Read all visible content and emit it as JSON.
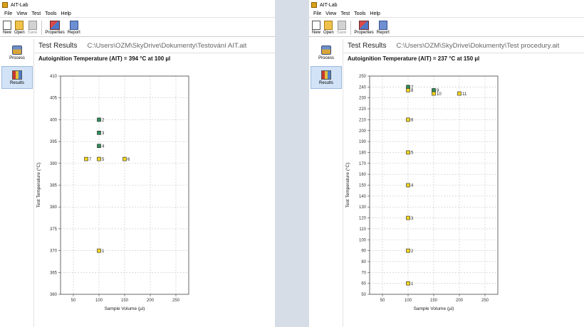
{
  "app": {
    "title": "AIT-Lab",
    "menu": [
      "File",
      "View",
      "Test",
      "Tools",
      "Help"
    ],
    "toolbar": {
      "new": "New",
      "open": "Open",
      "save": "Save",
      "properties": "Properties",
      "report": "Report"
    },
    "nav": {
      "process": "Process",
      "results": "Results"
    },
    "icons": {
      "new": "new-file-icon",
      "open": "folder-icon",
      "save": "save-icon",
      "properties": "properties-icon",
      "report": "report-icon",
      "process": "process-icon",
      "results": "bar-chart-icon"
    }
  },
  "panels": [
    {
      "header": "Test Results",
      "path": "C:\\Users\\OZM\\SkyDrive\\Dokumenty\\Testování AIT.ait",
      "summary": "Autoignition Temperature (AIT) = 394 °C at 100 µl",
      "chart_data": {
        "type": "scatter",
        "xlabel": "Sample Volume (µl)",
        "ylabel": "Test Temperature (°C)",
        "xlim": [
          25,
          275
        ],
        "ylim": [
          360,
          410
        ],
        "xticks": [
          50,
          100,
          150,
          200,
          250
        ],
        "yticks": [
          360,
          365,
          370,
          375,
          380,
          385,
          390,
          395,
          400,
          405,
          410
        ],
        "grid": true,
        "colors": {
          "ignition": "#2e8b57",
          "no_ignition": "#f2d51d"
        },
        "points": [
          {
            "x": 100,
            "y": 370,
            "label": "1",
            "result": "no_ignition"
          },
          {
            "x": 100,
            "y": 400,
            "label": "2",
            "result": "ignition"
          },
          {
            "x": 100,
            "y": 397,
            "label": "3",
            "result": "ignition"
          },
          {
            "x": 100,
            "y": 394,
            "label": "4",
            "result": "ignition"
          },
          {
            "x": 100,
            "y": 391,
            "label": "5",
            "result": "no_ignition"
          },
          {
            "x": 150,
            "y": 391,
            "label": "6",
            "result": "no_ignition"
          },
          {
            "x": 75,
            "y": 391,
            "label": "7",
            "result": "no_ignition"
          }
        ]
      }
    },
    {
      "header": "Test Results",
      "path": "C:\\Users\\OZM\\SkyDrive\\Dokumenty\\Test procedury.ait",
      "summary": "Autoignition Temperature (AIT) = 237 °C at 150 µl",
      "chart_data": {
        "type": "scatter",
        "xlabel": "Sample Volume (µl)",
        "ylabel": "Test Temperature (°C)",
        "xlim": [
          25,
          275
        ],
        "ylim": [
          50,
          250
        ],
        "xticks": [
          50,
          100,
          150,
          200,
          250
        ],
        "yticks": [
          50,
          60,
          70,
          80,
          90,
          100,
          110,
          120,
          130,
          140,
          150,
          160,
          170,
          180,
          190,
          200,
          210,
          220,
          230,
          240,
          250
        ],
        "grid": true,
        "colors": {
          "ignition": "#2e8b57",
          "no_ignition": "#f2d51d"
        },
        "points": [
          {
            "x": 100,
            "y": 60,
            "label": "1",
            "result": "no_ignition"
          },
          {
            "x": 100,
            "y": 90,
            "label": "2",
            "result": "no_ignition"
          },
          {
            "x": 100,
            "y": 120,
            "label": "3",
            "result": "no_ignition"
          },
          {
            "x": 100,
            "y": 150,
            "label": "4",
            "result": "no_ignition"
          },
          {
            "x": 100,
            "y": 180,
            "label": "5",
            "result": "no_ignition"
          },
          {
            "x": 100,
            "y": 210,
            "label": "6",
            "result": "no_ignition"
          },
          {
            "x": 100,
            "y": 240,
            "label": "7",
            "result": "ignition"
          },
          {
            "x": 100,
            "y": 237,
            "label": "8",
            "result": "no_ignition"
          },
          {
            "x": 150,
            "y": 237,
            "label": "9",
            "result": "ignition"
          },
          {
            "x": 150,
            "y": 234,
            "label": "10",
            "result": "no_ignition"
          },
          {
            "x": 200,
            "y": 234,
            "label": "11",
            "result": "no_ignition"
          }
        ]
      }
    }
  ]
}
